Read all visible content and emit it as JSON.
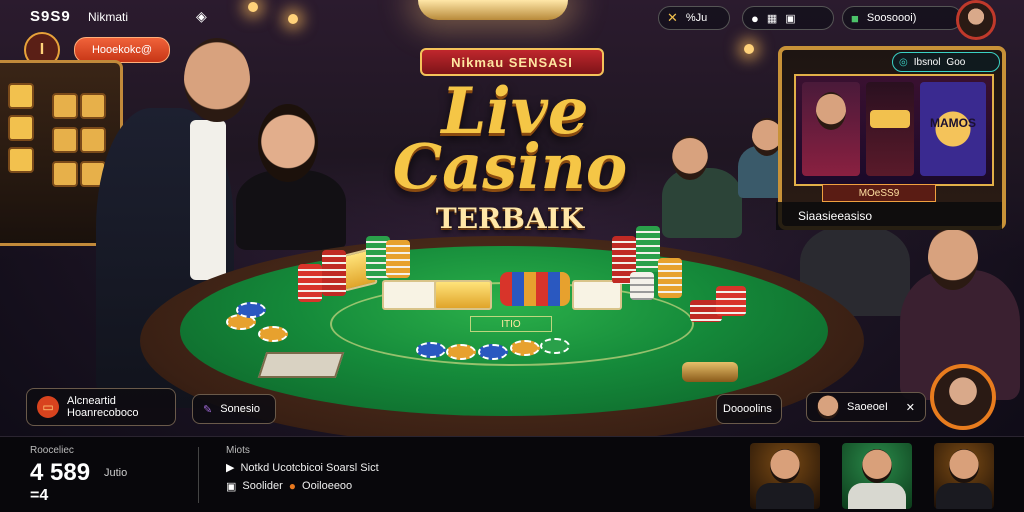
{
  "topbar": {
    "brand": "S9S9",
    "brand_sub": "Nikmati",
    "pill_left_label": "%Ju",
    "pill_right_label": "Soosoooi)"
  },
  "promo": {
    "badge_letter": "I",
    "button_label": "Hooekokc@"
  },
  "title": {
    "banner": "Nikmau SENSASI",
    "line1": "Live",
    "line2": "Casino",
    "line3": "TERBAIK"
  },
  "machine": {
    "top_label": "Ibsnol",
    "top_value": "Goo",
    "card_text": "MAMOS",
    "bar_label": "MOeSS9",
    "caption": "Siaasieeasiso"
  },
  "table": {
    "felt_label": "ITIO"
  },
  "callouts": {
    "left": {
      "line1": "Alcneartid",
      "line2": "Hoanrecoboco"
    },
    "mid": "Sonesio",
    "right1": "Doooolins",
    "right2": "SaoeoeI"
  },
  "bottom": {
    "label1": "Rooceliec",
    "big_value": "4 589",
    "unit": "Jutio",
    "small_value": "=4",
    "label2": "Miots",
    "row1": "Notkd Ucotcbicoi Soarsl Sict",
    "row2_left": "Soolider",
    "row2_right": "Ooiloeeoo"
  },
  "colors": {
    "accent_gold": "#f5c646",
    "felt_green": "#158a3a",
    "accent_orange": "#e87c1e"
  }
}
